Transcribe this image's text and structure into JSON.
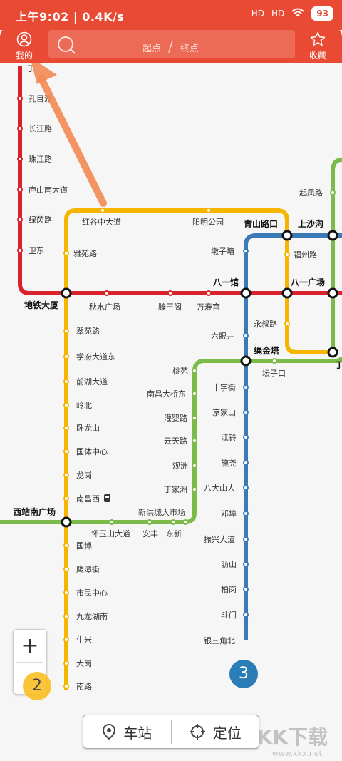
{
  "status": {
    "time": "上午9:02",
    "speed": "0.4K/s",
    "battery": "93",
    "net1": "HD",
    "net2": "HD"
  },
  "header": {
    "mine": "我的",
    "fav": "收藏",
    "from": "起点",
    "slash": "/",
    "to": "终点"
  },
  "stations": {
    "r_top": "丁",
    "r_kongmu": "孔目湖",
    "r_changjiang": "长江路",
    "r_zhujiang": "珠江路",
    "r_lushan": "庐山南大道",
    "r_lvyin": "绿茵路",
    "r_weidong": "卫东",
    "dtds": "地铁大厦",
    "qsgc": "秋水广场",
    "twg": "滕王阁",
    "wsg": "万寿宫",
    "byg": "八一馆",
    "bygc": "八一广场",
    "qslk": "青山路口",
    "ssg": "上沙沟",
    "hgzd": "红谷中大道",
    "ymgy": "阳明公园",
    "yyl": "雅苑路",
    "dzt": "墩子塘",
    "fzl": "福州路",
    "qfl": "起凤路",
    "yxl": "永叔路",
    "lyj": "六眼井",
    "sjt": "绳金塔",
    "tzk": "坛子口",
    "ding": "丁",
    "cyj": "翠苑路",
    "xfdd": "学府大道东",
    "qhdd": "前湖大道",
    "lb": "岭北",
    "wls": "卧龙山",
    "gtzx": "国体中心",
    "lg": "龙岗",
    "ncx": "南昌西",
    "xzngc": "西站南广场",
    "hysdd": "怀玉山大道",
    "af": "安丰",
    "dx": "东新",
    "gb": "国博",
    "ytj": "鹰潭街",
    "smzx": "市民中心",
    "jlhn": "九龙湖南",
    "sm": "生米",
    "dg": "大岗",
    "nl": "南路",
    "ty": "桃苑",
    "ncdqd": "南昌大桥东",
    "gyl": "灌婴路",
    "ytl": "云天路",
    "gz": "观洲",
    "djz": "丁家洲",
    "xhcdsc": "新洪城大市场",
    "szj": "十字街",
    "jjs": "京家山",
    "jl": "江铃",
    "sy": "施尧",
    "bdss": "八大山人",
    "db": "邓埠",
    "zxdd": "振兴大道",
    "ls": "沥山",
    "bg": "柏岗",
    "dm": "斗门",
    "ysjb": "银三角北"
  },
  "controls": {
    "plus": "+",
    "zoom_level": "2",
    "line_badge": "3",
    "station_btn": "车站",
    "locate_btn": "定位"
  },
  "watermark": {
    "main": "KK下载",
    "url": "www.kkx.net"
  },
  "colors": {
    "red": "#d8232a",
    "yellow": "#f7b500",
    "blue": "#3a7ab7",
    "green": "#7cbb4a",
    "header": "#e84a33"
  }
}
